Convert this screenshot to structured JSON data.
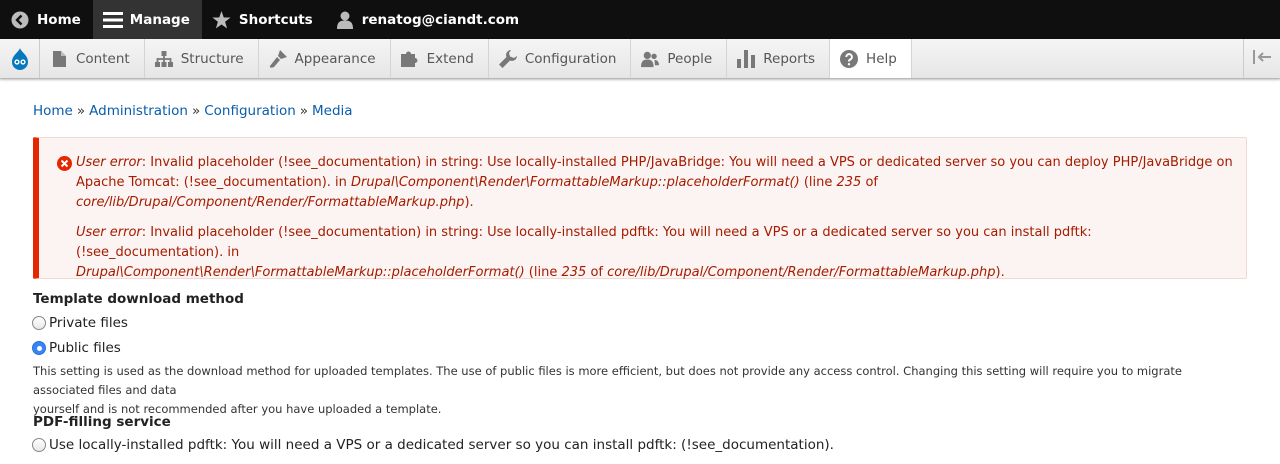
{
  "topbar": {
    "home": "Home",
    "manage": "Manage",
    "shortcuts": "Shortcuts",
    "user": "renatog@ciandt.com"
  },
  "tray": {
    "items": [
      {
        "label": "Content",
        "icon": "file-icon"
      },
      {
        "label": "Structure",
        "icon": "structure-icon"
      },
      {
        "label": "Appearance",
        "icon": "paintbrush-icon"
      },
      {
        "label": "Extend",
        "icon": "puzzle-icon"
      },
      {
        "label": "Configuration",
        "icon": "wrench-icon"
      },
      {
        "label": "People",
        "icon": "people-icon"
      },
      {
        "label": "Reports",
        "icon": "bar-chart-icon"
      },
      {
        "label": "Help",
        "icon": "help-icon"
      }
    ]
  },
  "breadcrumb": {
    "items": [
      "Home",
      "Administration",
      "Configuration",
      "Media"
    ],
    "separator": "»"
  },
  "messages": {
    "msg1": {
      "prefix": "User error",
      "text": ": Invalid placeholder (!see_documentation) in string: Use locally-installed PHP/JavaBridge: You will need a VPS or dedicated server so you can deploy PHP/JavaBridge on",
      "line2a": "Apache Tomcat: (!see_documentation). in ",
      "func": "Drupal\\Component\\Render\\FormattableMarkup::placeholderFormat()",
      "line2b": " (line ",
      "lineno": "235",
      "line2c": " of",
      "file": "core/lib/Drupal/Component/Render/FormattableMarkup.php",
      "end": ")."
    },
    "msg2": {
      "prefix": "User error",
      "text": ": Invalid placeholder (!see_documentation) in string: Use locally-installed pdftk: You will need a VPS or a dedicated server so you can install pdftk: (!see_documentation). in",
      "func": "Drupal\\Component\\Render\\FormattableMarkup::placeholderFormat()",
      "mid": " (line ",
      "lineno": "235",
      "of": " of ",
      "file": "core/lib/Drupal/Component/Render/FormattableMarkup.php",
      "end": ")."
    }
  },
  "form": {
    "template_label": "Template download method",
    "options": [
      {
        "label": "Private files",
        "checked": false
      },
      {
        "label": "Public files",
        "checked": true
      }
    ],
    "description_line1": "This setting is used as the download method for uploaded templates. The use of public files is more efficient, but does not provide any access control. Changing this setting will require you to migrate associated files and data",
    "description_line2": "yourself and is not recommended after you have uploaded a template.",
    "service_label": "PDF-filling service",
    "service_option": "Use locally-installed pdftk: You will need a VPS or a dedicated server so you can install pdftk: (!see_documentation)."
  },
  "colors": {
    "link": "#0a5dad",
    "error_text": "#a51b00",
    "error_border": "#e62600",
    "radio_checked": "#3585f5"
  }
}
